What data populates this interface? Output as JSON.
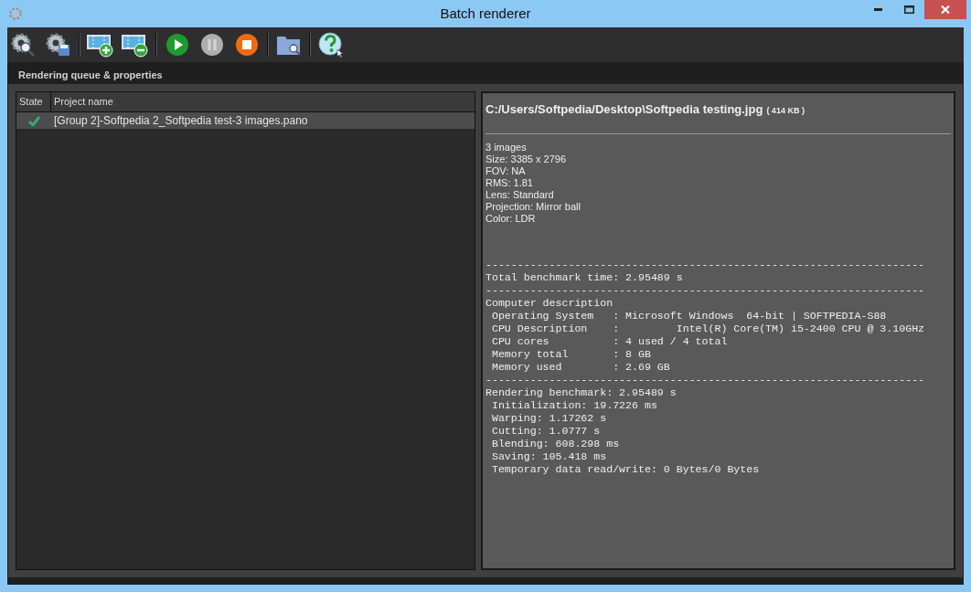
{
  "window": {
    "title": "Batch renderer"
  },
  "toolbar": [
    {
      "kind": "settings-search",
      "disabled": false
    },
    {
      "kind": "settings-save",
      "disabled": false
    },
    {
      "kind": "add",
      "disabled": false
    },
    {
      "kind": "remove",
      "disabled": false
    },
    {
      "kind": "play",
      "disabled": false
    },
    {
      "kind": "pause",
      "disabled": true
    },
    {
      "kind": "stop",
      "disabled": false
    },
    {
      "kind": "browse",
      "disabled": false
    },
    {
      "kind": "help",
      "disabled": false
    }
  ],
  "section_title": "Rendering queue & properties",
  "table": {
    "columns": [
      "State",
      "Project name"
    ],
    "rows": [
      {
        "done": true,
        "name": "[Group 2]-Softpedia 2_Softpedia test-3 images.pano",
        "selected": true
      }
    ]
  },
  "properties": {
    "path": "C:/Users/Softpedia/Desktop\\Softpedia testing.jpg",
    "size": "( 414 KB )",
    "info": [
      "3 images",
      "Size: 3385 x 2796",
      "FOV: NA",
      "RMS: 1.81",
      "Lens: Standard",
      "Projection: Mirror ball",
      "Color: LDR"
    ],
    "report": [
      "---------------------------------------------------------------------",
      "Total benchmark time: 2.95489 s",
      "---------------------------------------------------------------------",
      "Computer description",
      " Operating System   : Microsoft Windows  64-bit | SOFTPEDIA-S88",
      " CPU Description    :         Intel(R) Core(TM) i5-2400 CPU @ 3.10GHz",
      " CPU cores          : 4 used / 4 total",
      " Memory total       : 8 GB",
      " Memory used        : 2.69 GB",
      "---------------------------------------------------------------------",
      "Rendering benchmark: 2.95489 s",
      " Initialization: 19.7226 ms",
      " Warping: 1.17262 s",
      " Cutting: 1.0777 s",
      " Blending: 608.298 ms",
      " Saving: 105.418 ms",
      " Temporary data read/write: 0 Bytes/0 Bytes"
    ]
  }
}
